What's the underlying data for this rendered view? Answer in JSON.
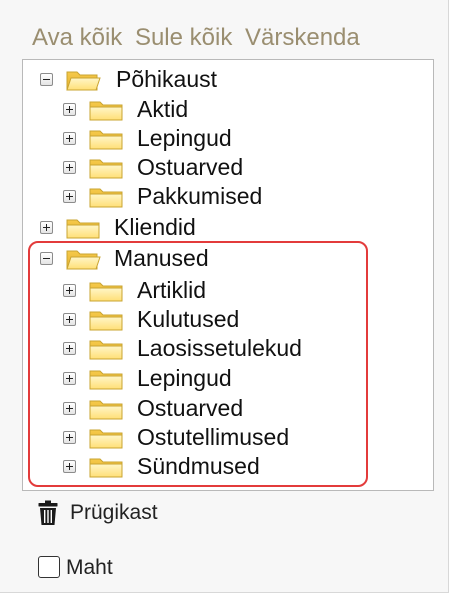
{
  "toolbar": {
    "open_all": "Ava kõik",
    "close_all": "Sule kõik",
    "refresh": "Värskenda"
  },
  "tree": {
    "root": {
      "label": "Põhikaust",
      "expanded": true,
      "children": [
        "Aktid",
        "Lepingud",
        "Ostuarved",
        "Pakkumised"
      ]
    },
    "clients": {
      "label": "Kliendid",
      "expanded": false
    },
    "attachments": {
      "label": "Manused",
      "expanded": true,
      "children": [
        "Artiklid",
        "Kulutused",
        "Laosissetulekud",
        "Lepingud",
        "Ostuarved",
        "Ostutellimused",
        "Sündmused"
      ]
    }
  },
  "trash": {
    "label": "Prügikast"
  },
  "size": {
    "label": "Maht",
    "checked": false
  },
  "colors": {
    "toolbar_text": "#9a8e70",
    "highlight": "#e33b3b",
    "folder_fill": "#ffe48a",
    "folder_stroke": "#c9a431"
  }
}
